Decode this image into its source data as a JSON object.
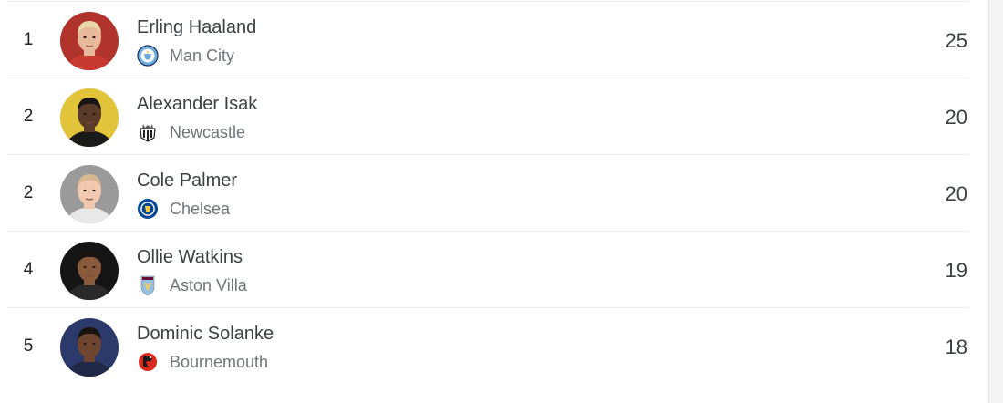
{
  "players": [
    {
      "rank": "1",
      "name": "Erling Haaland",
      "team": "Man City",
      "goals": "25",
      "avatar_bg": "#b1342c",
      "skin": "#e8b89a",
      "hair": "#e8d8a8",
      "shirt": "#c83a30",
      "crest_icon": "man-city-crest-icon"
    },
    {
      "rank": "2",
      "name": "Alexander Isak",
      "team": "Newcastle",
      "goals": "20",
      "avatar_bg": "#e2c43a",
      "skin": "#5a3a28",
      "hair": "#1a1410",
      "shirt": "#1a1a1a",
      "crest_icon": "newcastle-crest-icon"
    },
    {
      "rank": "2",
      "name": "Cole Palmer",
      "team": "Chelsea",
      "goals": "20",
      "avatar_bg": "#9a9a9a",
      "skin": "#f0c8b0",
      "hair": "#d8b890",
      "shirt": "#e8e8e8",
      "crest_icon": "chelsea-crest-icon"
    },
    {
      "rank": "4",
      "name": "Ollie Watkins",
      "team": "Aston Villa",
      "goals": "19",
      "avatar_bg": "#151515",
      "skin": "#8a5a3c",
      "hair": "#1c1410",
      "shirt": "#2a2a2a",
      "crest_icon": "aston-villa-crest-icon"
    },
    {
      "rank": "5",
      "name": "Dominic Solanke",
      "team": "Bournemouth",
      "goals": "18",
      "avatar_bg": "#2b3a6a",
      "skin": "#6e4530",
      "hair": "#1a1410",
      "shirt": "#202a48",
      "crest_icon": "bournemouth-crest-icon"
    }
  ],
  "colors": {
    "man_city": "#6cabdd",
    "newcastle": "#241f20",
    "chelsea": "#034694",
    "aston_villa": "#95bfe5",
    "aston_villa_claret": "#670e36",
    "bournemouth": "#da291c"
  }
}
